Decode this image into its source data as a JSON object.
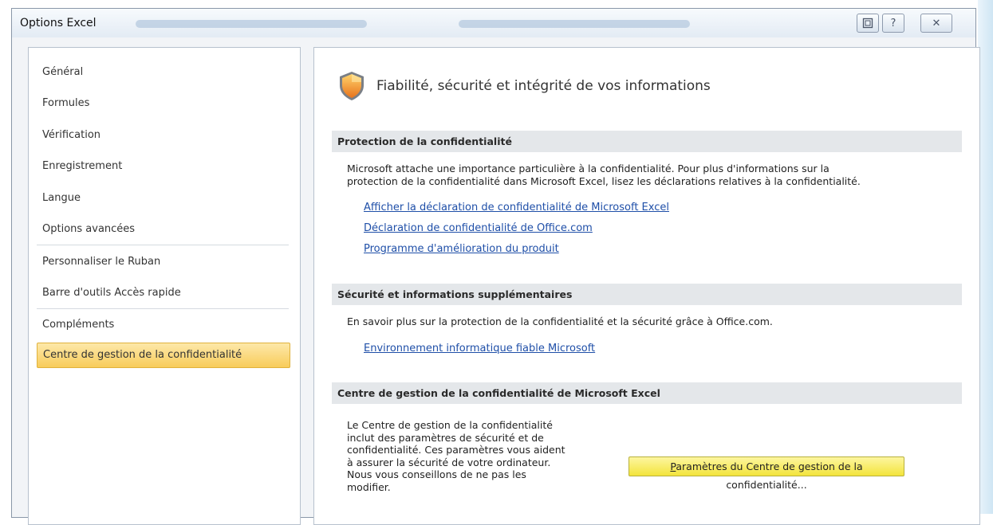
{
  "window": {
    "title": "Options Excel",
    "buttons": {
      "restore": "restore-icon",
      "help": "?",
      "close": "✕"
    }
  },
  "sidebar": {
    "items": [
      {
        "label": "Général",
        "selected": false
      },
      {
        "label": "Formules",
        "selected": false
      },
      {
        "label": "Vérification",
        "selected": false
      },
      {
        "label": "Enregistrement",
        "selected": false
      },
      {
        "label": "Langue",
        "selected": false
      },
      {
        "label": "Options avancées",
        "selected": false
      },
      {
        "label": "Personnaliser le Ruban",
        "selected": false
      },
      {
        "label": "Barre d'outils Accès rapide",
        "selected": false
      },
      {
        "label": "Compléments",
        "selected": false
      },
      {
        "label": "Centre de gestion de la confidentialité",
        "selected": true
      }
    ]
  },
  "main": {
    "title": "Fiabilité, sécurité et intégrité de vos informations",
    "privacy": {
      "header": "Protection de la confidentialité",
      "line1": "Microsoft attache une importance particulière à la confidentialité. Pour plus d'informations sur la",
      "line2": "protection de la confidentialité dans Microsoft Excel, lisez les déclarations relatives à la confidentialité.",
      "links": [
        "Afficher la déclaration de confidentialité de Microsoft Excel",
        "Déclaration de confidentialité de Office.com",
        "Programme d'amélioration du produit"
      ]
    },
    "security": {
      "header": "Sécurité et informations supplémentaires",
      "text": "En savoir plus sur la protection de la confidentialité et la sécurité grâce à Office.com.",
      "link": "Environnement informatique fiable Microsoft"
    },
    "trust_center": {
      "header": "Centre de gestion de la confidentialité de Microsoft Excel",
      "desc_lines": [
        "Le Centre de gestion de la confidentialité",
        "inclut des paramètres de sécurité et de",
        "confidentialité. Ces paramètres vous aident",
        "à assurer la sécurité de votre ordinateur.",
        "Nous vous conseillons de ne pas les",
        "modifier."
      ],
      "button_mnemonic": "P",
      "button_rest": "aramètres du Centre de gestion de la confidentialité..."
    }
  },
  "colors": {
    "selected_bg": "#f8cc5a",
    "button_bg": "#f3e43c",
    "link": "#1f4fa8",
    "section_bg": "#e4e7ea"
  }
}
